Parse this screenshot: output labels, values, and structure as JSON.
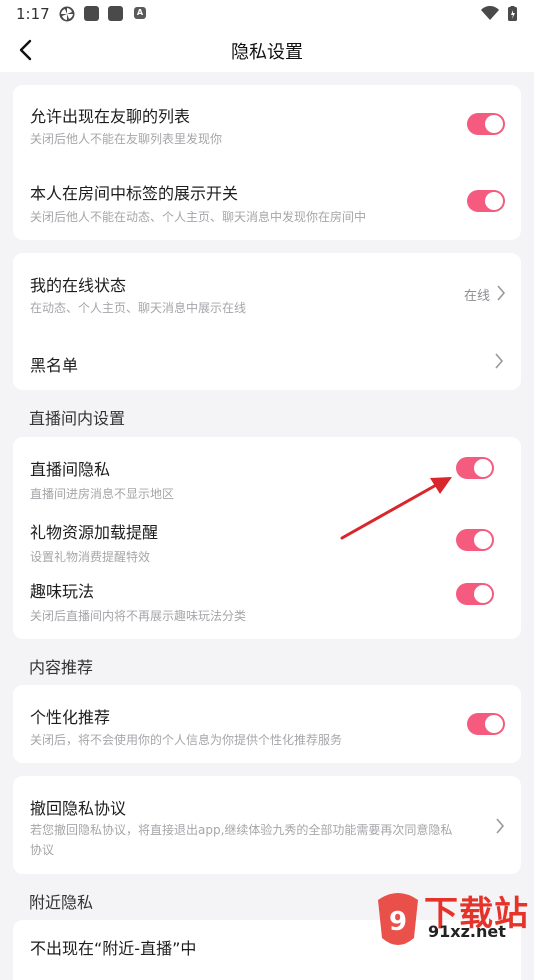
{
  "status_bar": {
    "time": "1:17",
    "notif_letter": "A"
  },
  "header": {
    "title": "隐私设置"
  },
  "card_friends": {
    "item1_title": "允许出现在友聊的列表",
    "item1_sub": "关闭后他人不能在友聊列表里发现你",
    "item1_on": true,
    "item2_title": "本人在房间中标签的展示开关",
    "item2_sub": "关闭后他人不能在动态、个人主页、聊天消息中发现你在房间中",
    "item2_on": true
  },
  "card_status": {
    "online_title": "我的在线状态",
    "online_sub": "在动态、个人主页、聊天消息中展示在线",
    "online_value": "在线",
    "blacklist_title": "黑名单"
  },
  "section_live": "直播间内设置",
  "card_live": {
    "privacy_title": "直播间隐私",
    "privacy_sub": "直播间进房消息不显示地区",
    "privacy_on": true,
    "gift_title": "礼物资源加载提醒",
    "gift_sub": "设置礼物消费提醒特效",
    "gift_on": true,
    "fun_title": "趣味玩法",
    "fun_sub": "关闭后直播间内将不再展示趣味玩法分类",
    "fun_on": true
  },
  "section_content": "内容推荐",
  "card_content": {
    "title": "个性化推荐",
    "sub": "关闭后，将不会使用你的个人信息为你提供个性化推荐服务",
    "on": true
  },
  "card_revoke": {
    "title": "撤回隐私协议",
    "sub": "若您撤回隐私协议，将直接退出app,继续体验九秀的全部功能需要再次同意隐私协议"
  },
  "section_nearby": "附近隐私",
  "nearby_item_title": "不出现在“附近-直播”中",
  "watermark": {
    "big": "下载站",
    "small": "91xz.net"
  },
  "colors": {
    "accent": "#f45b7e",
    "annotation_arrow": "#d8262b",
    "background": "#f4f4f6"
  }
}
